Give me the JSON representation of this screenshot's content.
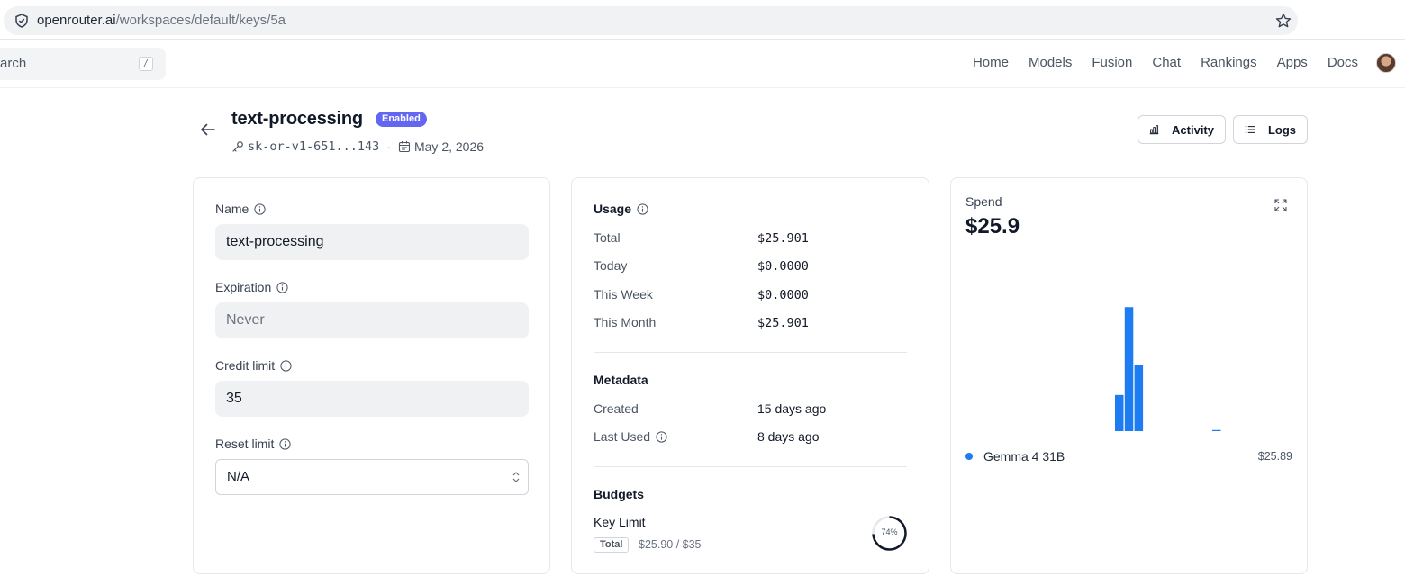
{
  "browser": {
    "url_host": "openrouter.ai",
    "url_path": "/workspaces/default/keys/5a"
  },
  "nav": {
    "search_placeholder": "arch",
    "search_shortcut": "/",
    "links": [
      "Home",
      "Models",
      "Fusion",
      "Chat",
      "Rankings",
      "Apps",
      "Docs"
    ]
  },
  "key": {
    "name": "text-processing",
    "status": "Enabled",
    "key_masked": "sk-or-v1-651...143",
    "expiry_date": "May 2, 2026",
    "accent": "#6366f1"
  },
  "actions": {
    "activity_label": "Activity",
    "logs_label": "Logs"
  },
  "form": {
    "name_label": "Name",
    "name_value": "text-processing",
    "expiration_label": "Expiration",
    "expiration_placeholder": "Never",
    "credit_limit_label": "Credit limit",
    "credit_limit_value": "35",
    "reset_limit_label": "Reset limit",
    "reset_limit_value": "N/A"
  },
  "usage": {
    "title": "Usage",
    "rows": [
      {
        "label": "Total",
        "value": "$25.901"
      },
      {
        "label": "Today",
        "value": "$0.0000"
      },
      {
        "label": "This Week",
        "value": "$0.0000"
      },
      {
        "label": "This Month",
        "value": "$25.901"
      }
    ]
  },
  "metadata": {
    "title": "Metadata",
    "created_label": "Created",
    "created_value": "15 days ago",
    "last_used_label": "Last Used",
    "last_used_value": "8 days ago"
  },
  "budgets": {
    "title": "Budgets",
    "limit_title": "Key Limit",
    "tag": "Total",
    "amount": "$25.90 / $35",
    "percent_label": "74%",
    "percent": 0.74
  },
  "spend": {
    "label": "Spend",
    "value": "$25.9",
    "legend_name": "Gemma 4 31B",
    "legend_value": "$25.89",
    "color": "#1d7cf2"
  },
  "chart_data": {
    "type": "bar",
    "title": "",
    "xlabel": "",
    "ylabel": "",
    "series": [
      {
        "name": "Gemma 4 31B",
        "values": [
          4.9,
          16.8,
          9.0,
          0,
          0,
          0,
          0,
          0,
          0,
          0,
          0.15
        ]
      }
    ],
    "ylim": [
      0,
      20
    ],
    "grid": false
  }
}
